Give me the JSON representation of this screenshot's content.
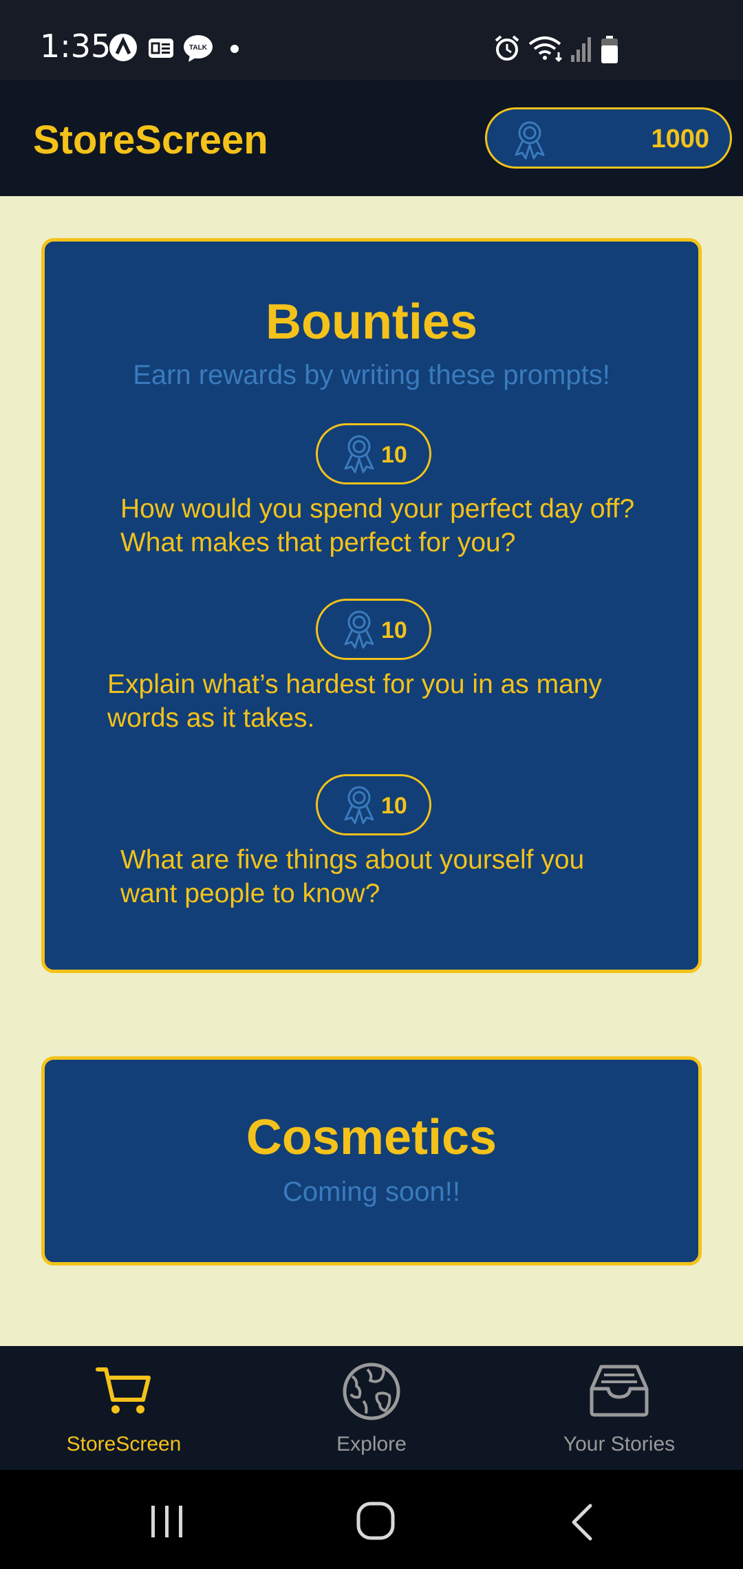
{
  "status_bar": {
    "time": "1:35",
    "left_icons": [
      "app-a-icon",
      "ge-icon",
      "talk-icon",
      "dot-icon"
    ],
    "right_icons": [
      "alarm-icon",
      "wifi-icon",
      "signal-icon",
      "battery-icon"
    ]
  },
  "header": {
    "title": "StoreScreen",
    "coins": "1000",
    "coin_icon": "award-icon"
  },
  "bounties": {
    "title": "Bounties",
    "subtitle": "Earn rewards by writing these prompts!",
    "items": [
      {
        "reward": "10",
        "prompt": "How would you spend your perfect day off? What makes that perfect for you?"
      },
      {
        "reward": "10",
        "prompt": "Explain what’s hardest for you in as many words as it takes."
      },
      {
        "reward": "10",
        "prompt": "What are five things about yourself you want people to know?"
      }
    ]
  },
  "cosmetics": {
    "title": "Cosmetics",
    "subtitle": "Coming soon!!"
  },
  "bottom_nav": {
    "items": [
      {
        "label": "StoreScreen",
        "icon": "cart-icon",
        "active": true
      },
      {
        "label": "Explore",
        "icon": "globe-icon",
        "active": false
      },
      {
        "label": "Your Stories",
        "icon": "inbox-icon",
        "active": false
      }
    ]
  },
  "system_nav": {
    "buttons": [
      "recents-icon",
      "home-icon",
      "back-icon"
    ]
  },
  "colors": {
    "accent": "#f4c21a",
    "card": "#123f77",
    "background": "#eeeec9",
    "header": "#0e1624",
    "subtitle": "#3a7bbd"
  }
}
